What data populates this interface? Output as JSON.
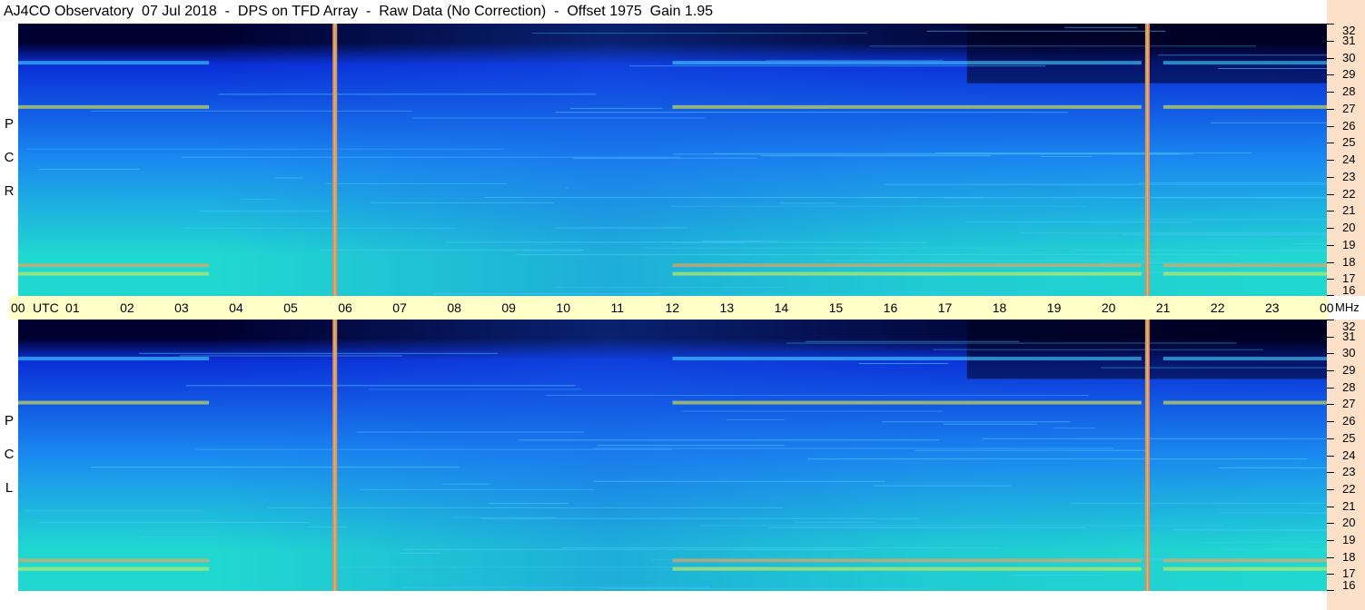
{
  "title": "AJ4CO Observatory  07 Jul 2018  -  DPS on TFD Array  -  Raw Data (No Correction)  -  Offset 1975  Gain 1.95",
  "chart_data": [
    {
      "type": "heatmap",
      "channel": "R C P",
      "channel_letters": [
        "R",
        "C",
        "P"
      ],
      "x_range_utc": [
        0,
        24
      ],
      "y_range_mhz": [
        16,
        32
      ],
      "colormap": [
        "#000030",
        "#0a2ed8",
        "#1a8af0",
        "#20d8d0",
        "#f0f050",
        "#ff6060"
      ],
      "strong_emission_bands_mhz": [
        17.3,
        17.8,
        27.1,
        29.7
      ],
      "interference_lines_utc": [
        5.8,
        20.7
      ]
    },
    {
      "type": "heatmap",
      "channel": "L C P",
      "channel_letters": [
        "L",
        "C",
        "P"
      ],
      "x_range_utc": [
        0,
        24
      ],
      "y_range_mhz": [
        16,
        32
      ],
      "colormap": [
        "#000030",
        "#0a2ed8",
        "#1a8af0",
        "#20d8d0",
        "#f0f050",
        "#ff6060"
      ],
      "strong_emission_bands_mhz": [
        17.3,
        17.8,
        27.1,
        29.7
      ],
      "interference_lines_utc": [
        5.8,
        20.7
      ]
    }
  ],
  "time_axis": {
    "labels": [
      "00",
      "UTC",
      "01",
      "02",
      "03",
      "04",
      "05",
      "06",
      "07",
      "08",
      "09",
      "10",
      "11",
      "12",
      "13",
      "14",
      "15",
      "16",
      "17",
      "18",
      "19",
      "20",
      "21",
      "22",
      "23",
      "00"
    ],
    "unit": "MHz"
  },
  "freq_axis": {
    "ticks": [
      "32",
      "31",
      "30",
      "29",
      "28",
      "27",
      "26",
      "25",
      "24",
      "23",
      "22",
      "21",
      "20",
      "19",
      "18",
      "17",
      "16"
    ]
  }
}
